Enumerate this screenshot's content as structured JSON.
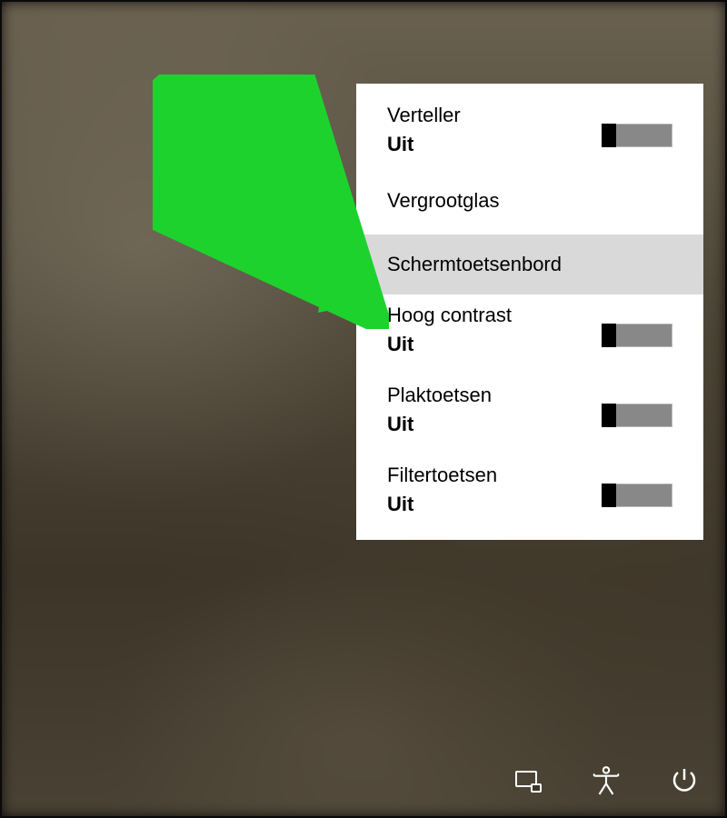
{
  "accent_color": "#1ed22e",
  "status_off": "Uit",
  "flyout": {
    "items": [
      {
        "label": "Verteller",
        "status": "Uit",
        "toggle": true,
        "state": "off"
      },
      {
        "label": "Vergrootglas",
        "toggle": false
      },
      {
        "label": "Schermtoetsenbord",
        "toggle": false,
        "highlight": true
      },
      {
        "label": "Hoog contrast",
        "status": "Uit",
        "toggle": true,
        "state": "off"
      },
      {
        "label": "Plaktoetsen",
        "status": "Uit",
        "toggle": true,
        "state": "off"
      },
      {
        "label": "Filtertoetsen",
        "status": "Uit",
        "toggle": true,
        "state": "off"
      }
    ]
  },
  "tray": {
    "network": "network-icon",
    "accessibility": "accessibility-icon",
    "power": "power-icon"
  }
}
